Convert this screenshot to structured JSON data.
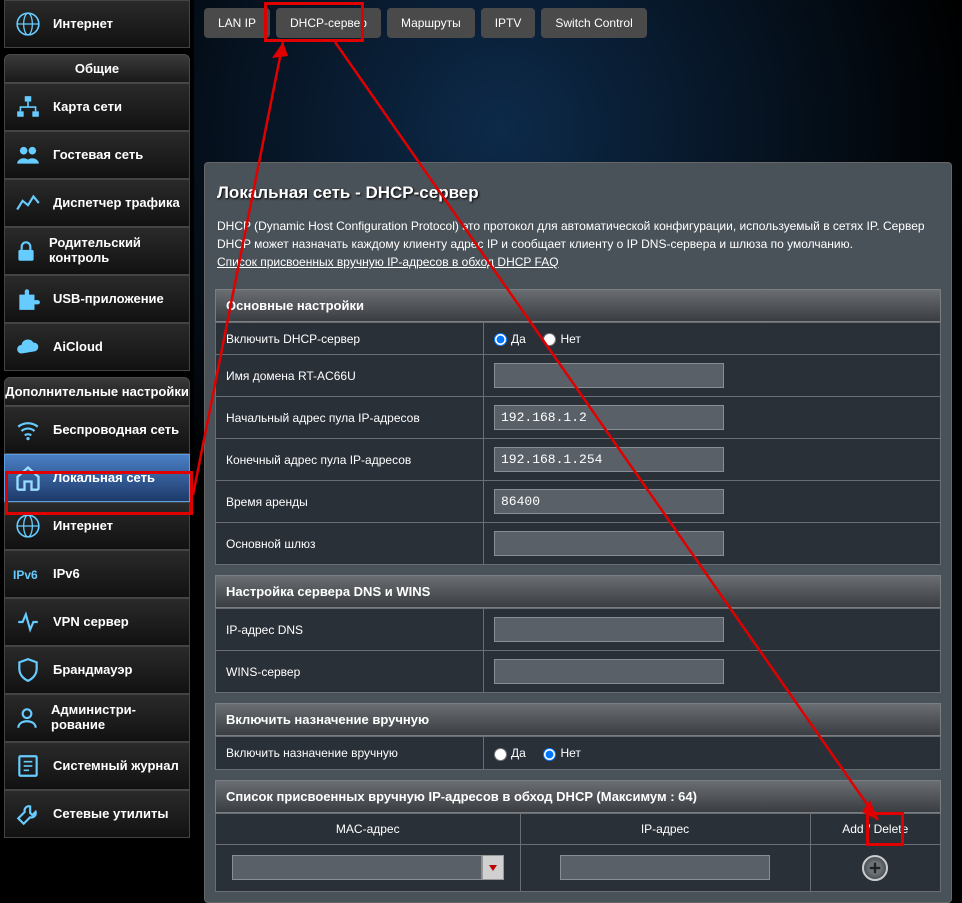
{
  "sidebar": {
    "top_item": "Интернет",
    "section1_title": "Общие",
    "general_items": [
      {
        "label": "Карта сети",
        "icon": "network-map"
      },
      {
        "label": "Гостевая сеть",
        "icon": "guest"
      },
      {
        "label": "Диспетчер трафика",
        "icon": "traffic"
      },
      {
        "label": "Родительский контроль",
        "icon": "lock"
      },
      {
        "label": "USB-приложение",
        "icon": "usb"
      },
      {
        "label": "AiCloud",
        "icon": "cloud"
      }
    ],
    "section2_title": "Дополнительные настройки",
    "advanced_items": [
      {
        "label": "Беспроводная сеть",
        "icon": "wifi"
      },
      {
        "label": "Локальная сеть",
        "icon": "home",
        "active": true
      },
      {
        "label": "Интернет",
        "icon": "globe"
      },
      {
        "label": "IPv6",
        "icon": "ipv6"
      },
      {
        "label": "VPN сервер",
        "icon": "vpn"
      },
      {
        "label": "Брандмауэр",
        "icon": "shield"
      },
      {
        "label": "Администри-рование",
        "icon": "admin"
      },
      {
        "label": "Системный журнал",
        "icon": "log"
      },
      {
        "label": "Сетевые утилиты",
        "icon": "tools"
      }
    ]
  },
  "tabs": [
    "LAN IP",
    "DHCP-сервер",
    "Маршруты",
    "IPTV",
    "Switch Control"
  ],
  "page_title": "Локальная сеть - DHCP-сервер",
  "description": "DHCP (Dynamic Host Configuration Protocol) это протокол для автоматической конфигурации, используемый в сетях IP. Сервер DHCP может назначать каждому клиенту адрес IP и сообщает клиенту о IP DNS-сервера и шлюза по умолчанию.",
  "faq_link": "Список присвоенных вручную IP-адресов в обход DHCP FAQ",
  "sections": {
    "basic": {
      "title": "Основные настройки",
      "rows": {
        "enable": {
          "label": "Включить DHCP-сервер",
          "yes": "Да",
          "no": "Нет"
        },
        "domain": {
          "label": "Имя домена RT-AC66U",
          "value": ""
        },
        "pool_start": {
          "label": "Начальный адрес пула IP-адресов",
          "value": "192.168.1.2"
        },
        "pool_end": {
          "label": "Конечный адрес пула IP-адресов",
          "value": "192.168.1.254"
        },
        "lease": {
          "label": "Время аренды",
          "value": "86400"
        },
        "gateway": {
          "label": "Основной шлюз",
          "value": ""
        }
      }
    },
    "dns": {
      "title": "Настройка сервера DNS и WINS",
      "rows": {
        "dns": {
          "label": "IP-адрес DNS",
          "value": ""
        },
        "wins": {
          "label": "WINS-сервер",
          "value": ""
        }
      }
    },
    "manual": {
      "title": "Включить назначение вручную",
      "rows": {
        "enable": {
          "label": "Включить назначение вручную",
          "yes": "Да",
          "no": "Нет"
        }
      }
    },
    "list": {
      "title": "Список присвоенных вручную IP-адресов в обход DHCP (Максимум : 64)",
      "cols": {
        "mac": "MAC-адрес",
        "ip": "IP-адрес",
        "action": "Add / Delete"
      }
    }
  }
}
